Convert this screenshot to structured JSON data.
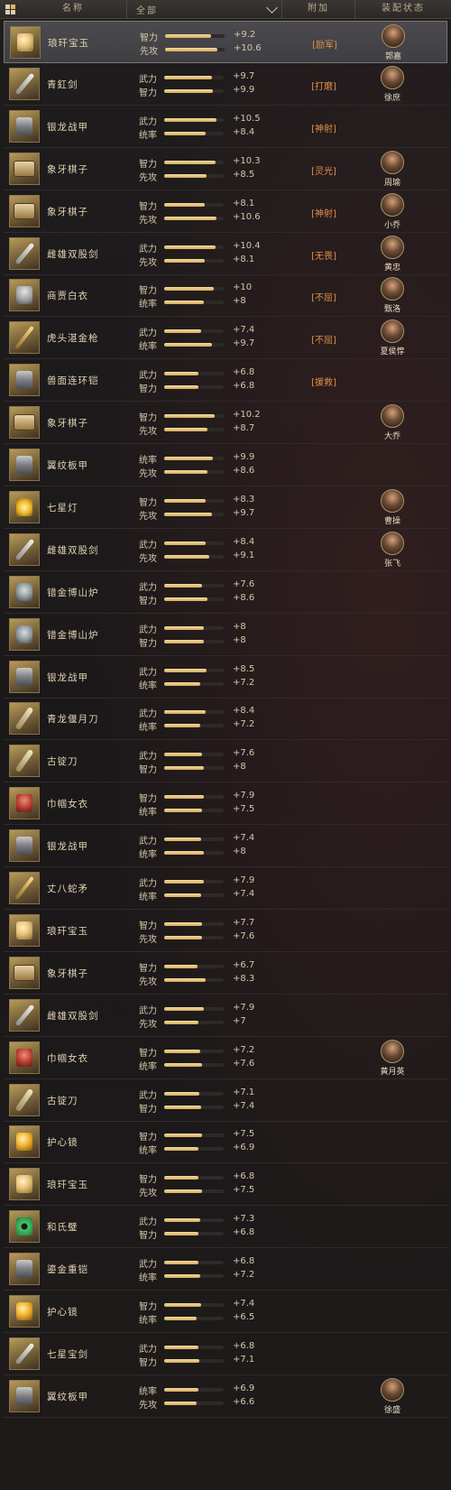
{
  "header": {
    "name_label": "名称",
    "filter_label": "全部",
    "extra_label": "附加",
    "status_label": "装配状态"
  },
  "colors": {
    "accent_gold": "#d4ad5c",
    "extra_text": "#e08f46",
    "selected_row": "#4b4a4e"
  },
  "items": [
    {
      "name": "琅玕宝玉",
      "icon": "jade-icon",
      "s1": {
        "label": "智力",
        "value": "+9.2",
        "level": 0.77
      },
      "s2": {
        "label": "先攻",
        "value": "+10.6",
        "level": 0.88
      },
      "extra": "[励军]",
      "equipped_by": "郭嘉",
      "selected": true
    },
    {
      "name": "青釭剑",
      "icon": "sword-icon",
      "s1": {
        "label": "武力",
        "value": "+9.7",
        "level": 0.81
      },
      "s2": {
        "label": "智力",
        "value": "+9.9",
        "level": 0.82
      },
      "extra": "[打磨]",
      "equipped_by": "徐庶"
    },
    {
      "name": "银龙战甲",
      "icon": "armor-icon",
      "s1": {
        "label": "武力",
        "value": "+10.5",
        "level": 0.88
      },
      "s2": {
        "label": "统率",
        "value": "+8.4",
        "level": 0.7
      },
      "extra": "[神射]",
      "equipped_by": ""
    },
    {
      "name": "象牙棋子",
      "icon": "chess-icon",
      "s1": {
        "label": "智力",
        "value": "+10.3",
        "level": 0.86
      },
      "s2": {
        "label": "先攻",
        "value": "+8.5",
        "level": 0.71
      },
      "extra": "[灵光]",
      "equipped_by": "周瑜"
    },
    {
      "name": "象牙棋子",
      "icon": "chess-icon",
      "s1": {
        "label": "智力",
        "value": "+8.1",
        "level": 0.68
      },
      "s2": {
        "label": "先攻",
        "value": "+10.6",
        "level": 0.88
      },
      "extra": "[神射]",
      "equipped_by": "小乔"
    },
    {
      "name": "雌雄双股剑",
      "icon": "sword-icon",
      "s1": {
        "label": "武力",
        "value": "+10.4",
        "level": 0.87
      },
      "s2": {
        "label": "先攻",
        "value": "+8.1",
        "level": 0.68
      },
      "extra": "[无畏]",
      "equipped_by": "黄忠"
    },
    {
      "name": "商贾白衣",
      "icon": "helmet-icon",
      "s1": {
        "label": "智力",
        "value": "+10",
        "level": 0.83
      },
      "s2": {
        "label": "统率",
        "value": "+8",
        "level": 0.67
      },
      "extra": "[不屈]",
      "equipped_by": "甄洛"
    },
    {
      "name": "虎头湛金枪",
      "icon": "spear-icon",
      "s1": {
        "label": "武力",
        "value": "+7.4",
        "level": 0.62
      },
      "s2": {
        "label": "统率",
        "value": "+9.7",
        "level": 0.81
      },
      "extra": "[不屈]",
      "equipped_by": "夏侯惇"
    },
    {
      "name": "兽面连环铠",
      "icon": "armor-icon",
      "s1": {
        "label": "武力",
        "value": "+6.8",
        "level": 0.57
      },
      "s2": {
        "label": "智力",
        "value": "+6.8",
        "level": 0.57
      },
      "extra": "[援救]",
      "equipped_by": ""
    },
    {
      "name": "象牙棋子",
      "icon": "chess-icon",
      "s1": {
        "label": "智力",
        "value": "+10.2",
        "level": 0.85
      },
      "s2": {
        "label": "先攻",
        "value": "+8.7",
        "level": 0.73
      },
      "extra": "",
      "equipped_by": "大乔"
    },
    {
      "name": "翼纹板甲",
      "icon": "armor-icon",
      "s1": {
        "label": "统率",
        "value": "+9.9",
        "level": 0.82
      },
      "s2": {
        "label": "先攻",
        "value": "+8.6",
        "level": 0.72
      },
      "extra": "",
      "equipped_by": ""
    },
    {
      "name": "七星灯",
      "icon": "lamp-icon",
      "s1": {
        "label": "智力",
        "value": "+8.3",
        "level": 0.69
      },
      "s2": {
        "label": "先攻",
        "value": "+9.7",
        "level": 0.81
      },
      "extra": "",
      "equipped_by": "曹操"
    },
    {
      "name": "雌雄双股剑",
      "icon": "sword-icon",
      "s1": {
        "label": "武力",
        "value": "+8.4",
        "level": 0.7
      },
      "s2": {
        "label": "先攻",
        "value": "+9.1",
        "level": 0.76
      },
      "extra": "",
      "equipped_by": "张飞"
    },
    {
      "name": "错金博山炉",
      "icon": "censer-icon",
      "s1": {
        "label": "武力",
        "value": "+7.6",
        "level": 0.63
      },
      "s2": {
        "label": "智力",
        "value": "+8.6",
        "level": 0.72
      },
      "extra": "",
      "equipped_by": ""
    },
    {
      "name": "错金博山炉",
      "icon": "censer-icon",
      "s1": {
        "label": "武力",
        "value": "+8",
        "level": 0.67
      },
      "s2": {
        "label": "智力",
        "value": "+8",
        "level": 0.67
      },
      "extra": "",
      "equipped_by": ""
    },
    {
      "name": "银龙战甲",
      "icon": "armor-icon",
      "s1": {
        "label": "武力",
        "value": "+8.5",
        "level": 0.71
      },
      "s2": {
        "label": "统率",
        "value": "+7.2",
        "level": 0.6
      },
      "extra": "",
      "equipped_by": ""
    },
    {
      "name": "青龙偃月刀",
      "icon": "blade-icon",
      "s1": {
        "label": "武力",
        "value": "+8.4",
        "level": 0.7
      },
      "s2": {
        "label": "统率",
        "value": "+7.2",
        "level": 0.6
      },
      "extra": "",
      "equipped_by": ""
    },
    {
      "name": "古锭刀",
      "icon": "blade-icon",
      "s1": {
        "label": "武力",
        "value": "+7.6",
        "level": 0.63
      },
      "s2": {
        "label": "智力",
        "value": "+8",
        "level": 0.67
      },
      "extra": "",
      "equipped_by": ""
    },
    {
      "name": "巾帼女衣",
      "icon": "robe-icon",
      "s1": {
        "label": "智力",
        "value": "+7.9",
        "level": 0.66
      },
      "s2": {
        "label": "统率",
        "value": "+7.5",
        "level": 0.63
      },
      "extra": "",
      "equipped_by": ""
    },
    {
      "name": "银龙战甲",
      "icon": "armor-icon",
      "s1": {
        "label": "武力",
        "value": "+7.4",
        "level": 0.62
      },
      "s2": {
        "label": "统率",
        "value": "+8",
        "level": 0.67
      },
      "extra": "",
      "equipped_by": ""
    },
    {
      "name": "丈八蛇矛",
      "icon": "spear-icon",
      "s1": {
        "label": "武力",
        "value": "+7.9",
        "level": 0.66
      },
      "s2": {
        "label": "统率",
        "value": "+7.4",
        "level": 0.62
      },
      "extra": "",
      "equipped_by": ""
    },
    {
      "name": "琅玕宝玉",
      "icon": "jade-icon",
      "s1": {
        "label": "智力",
        "value": "+7.7",
        "level": 0.64
      },
      "s2": {
        "label": "先攻",
        "value": "+7.6",
        "level": 0.63
      },
      "extra": "",
      "equipped_by": ""
    },
    {
      "name": "象牙棋子",
      "icon": "chess-icon",
      "s1": {
        "label": "智力",
        "value": "+6.7",
        "level": 0.56
      },
      "s2": {
        "label": "先攻",
        "value": "+8.3",
        "level": 0.69
      },
      "extra": "",
      "equipped_by": ""
    },
    {
      "name": "雌雄双股剑",
      "icon": "sword-icon",
      "s1": {
        "label": "武力",
        "value": "+7.9",
        "level": 0.66
      },
      "s2": {
        "label": "先攻",
        "value": "+7",
        "level": 0.58
      },
      "extra": "",
      "equipped_by": ""
    },
    {
      "name": "巾帼女衣",
      "icon": "robe-icon",
      "s1": {
        "label": "智力",
        "value": "+7.2",
        "level": 0.6
      },
      "s2": {
        "label": "统率",
        "value": "+7.6",
        "level": 0.63
      },
      "extra": "",
      "equipped_by": "黄月英"
    },
    {
      "name": "古锭刀",
      "icon": "blade-icon",
      "s1": {
        "label": "武力",
        "value": "+7.1",
        "level": 0.59
      },
      "s2": {
        "label": "智力",
        "value": "+7.4",
        "level": 0.62
      },
      "extra": "",
      "equipped_by": ""
    },
    {
      "name": "护心镜",
      "icon": "mirror-icon",
      "s1": {
        "label": "智力",
        "value": "+7.5",
        "level": 0.63
      },
      "s2": {
        "label": "统率",
        "value": "+6.9",
        "level": 0.58
      },
      "extra": "",
      "equipped_by": ""
    },
    {
      "name": "琅玕宝玉",
      "icon": "jade-icon",
      "s1": {
        "label": "智力",
        "value": "+6.8",
        "level": 0.57
      },
      "s2": {
        "label": "先攻",
        "value": "+7.5",
        "level": 0.63
      },
      "extra": "",
      "equipped_by": ""
    },
    {
      "name": "和氏璧",
      "icon": "bi-disc-icon",
      "s1": {
        "label": "武力",
        "value": "+7.3",
        "level": 0.61
      },
      "s2": {
        "label": "智力",
        "value": "+6.8",
        "level": 0.57
      },
      "extra": "",
      "equipped_by": ""
    },
    {
      "name": "鎏金重铠",
      "icon": "armor-icon",
      "s1": {
        "label": "武力",
        "value": "+6.8",
        "level": 0.57
      },
      "s2": {
        "label": "统率",
        "value": "+7.2",
        "level": 0.6
      },
      "extra": "",
      "equipped_by": ""
    },
    {
      "name": "护心镜",
      "icon": "mirror-icon",
      "s1": {
        "label": "智力",
        "value": "+7.4",
        "level": 0.62
      },
      "s2": {
        "label": "统率",
        "value": "+6.5",
        "level": 0.54
      },
      "extra": "",
      "equipped_by": ""
    },
    {
      "name": "七星宝剑",
      "icon": "sword-icon",
      "s1": {
        "label": "武力",
        "value": "+6.8",
        "level": 0.57
      },
      "s2": {
        "label": "智力",
        "value": "+7.1",
        "level": 0.59
      },
      "extra": "",
      "equipped_by": ""
    },
    {
      "name": "翼纹板甲",
      "icon": "armor-icon",
      "s1": {
        "label": "统率",
        "value": "+6.9",
        "level": 0.58
      },
      "s2": {
        "label": "先攻",
        "value": "+6.6",
        "level": 0.55
      },
      "extra": "",
      "equipped_by": "徐盛"
    }
  ]
}
